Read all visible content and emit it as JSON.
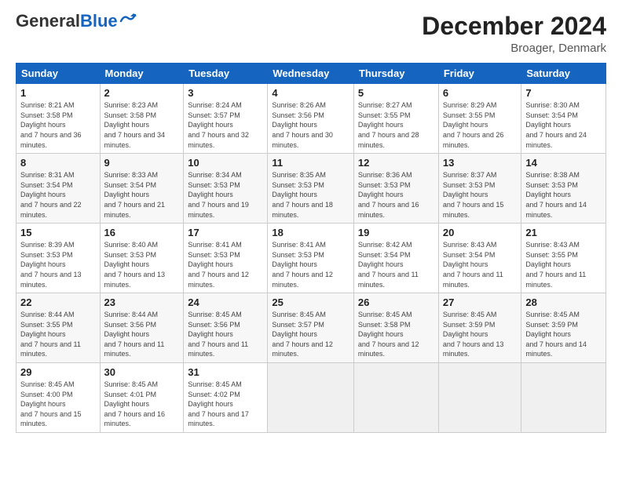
{
  "logo": {
    "general": "General",
    "blue": "Blue"
  },
  "title": "December 2024",
  "location": "Broager, Denmark",
  "days_header": [
    "Sunday",
    "Monday",
    "Tuesday",
    "Wednesday",
    "Thursday",
    "Friday",
    "Saturday"
  ],
  "weeks": [
    [
      {
        "day": "1",
        "sunrise": "8:21 AM",
        "sunset": "3:58 PM",
        "daylight": "7 hours and 36 minutes."
      },
      {
        "day": "2",
        "sunrise": "8:23 AM",
        "sunset": "3:58 PM",
        "daylight": "7 hours and 34 minutes."
      },
      {
        "day": "3",
        "sunrise": "8:24 AM",
        "sunset": "3:57 PM",
        "daylight": "7 hours and 32 minutes."
      },
      {
        "day": "4",
        "sunrise": "8:26 AM",
        "sunset": "3:56 PM",
        "daylight": "7 hours and 30 minutes."
      },
      {
        "day": "5",
        "sunrise": "8:27 AM",
        "sunset": "3:55 PM",
        "daylight": "7 hours and 28 minutes."
      },
      {
        "day": "6",
        "sunrise": "8:29 AM",
        "sunset": "3:55 PM",
        "daylight": "7 hours and 26 minutes."
      },
      {
        "day": "7",
        "sunrise": "8:30 AM",
        "sunset": "3:54 PM",
        "daylight": "7 hours and 24 minutes."
      }
    ],
    [
      {
        "day": "8",
        "sunrise": "8:31 AM",
        "sunset": "3:54 PM",
        "daylight": "7 hours and 22 minutes."
      },
      {
        "day": "9",
        "sunrise": "8:33 AM",
        "sunset": "3:54 PM",
        "daylight": "7 hours and 21 minutes."
      },
      {
        "day": "10",
        "sunrise": "8:34 AM",
        "sunset": "3:53 PM",
        "daylight": "7 hours and 19 minutes."
      },
      {
        "day": "11",
        "sunrise": "8:35 AM",
        "sunset": "3:53 PM",
        "daylight": "7 hours and 18 minutes."
      },
      {
        "day": "12",
        "sunrise": "8:36 AM",
        "sunset": "3:53 PM",
        "daylight": "7 hours and 16 minutes."
      },
      {
        "day": "13",
        "sunrise": "8:37 AM",
        "sunset": "3:53 PM",
        "daylight": "7 hours and 15 minutes."
      },
      {
        "day": "14",
        "sunrise": "8:38 AM",
        "sunset": "3:53 PM",
        "daylight": "7 hours and 14 minutes."
      }
    ],
    [
      {
        "day": "15",
        "sunrise": "8:39 AM",
        "sunset": "3:53 PM",
        "daylight": "7 hours and 13 minutes."
      },
      {
        "day": "16",
        "sunrise": "8:40 AM",
        "sunset": "3:53 PM",
        "daylight": "7 hours and 13 minutes."
      },
      {
        "day": "17",
        "sunrise": "8:41 AM",
        "sunset": "3:53 PM",
        "daylight": "7 hours and 12 minutes."
      },
      {
        "day": "18",
        "sunrise": "8:41 AM",
        "sunset": "3:53 PM",
        "daylight": "7 hours and 12 minutes."
      },
      {
        "day": "19",
        "sunrise": "8:42 AM",
        "sunset": "3:54 PM",
        "daylight": "7 hours and 11 minutes."
      },
      {
        "day": "20",
        "sunrise": "8:43 AM",
        "sunset": "3:54 PM",
        "daylight": "7 hours and 11 minutes."
      },
      {
        "day": "21",
        "sunrise": "8:43 AM",
        "sunset": "3:55 PM",
        "daylight": "7 hours and 11 minutes."
      }
    ],
    [
      {
        "day": "22",
        "sunrise": "8:44 AM",
        "sunset": "3:55 PM",
        "daylight": "7 hours and 11 minutes."
      },
      {
        "day": "23",
        "sunrise": "8:44 AM",
        "sunset": "3:56 PM",
        "daylight": "7 hours and 11 minutes."
      },
      {
        "day": "24",
        "sunrise": "8:45 AM",
        "sunset": "3:56 PM",
        "daylight": "7 hours and 11 minutes."
      },
      {
        "day": "25",
        "sunrise": "8:45 AM",
        "sunset": "3:57 PM",
        "daylight": "7 hours and 12 minutes."
      },
      {
        "day": "26",
        "sunrise": "8:45 AM",
        "sunset": "3:58 PM",
        "daylight": "7 hours and 12 minutes."
      },
      {
        "day": "27",
        "sunrise": "8:45 AM",
        "sunset": "3:59 PM",
        "daylight": "7 hours and 13 minutes."
      },
      {
        "day": "28",
        "sunrise": "8:45 AM",
        "sunset": "3:59 PM",
        "daylight": "7 hours and 14 minutes."
      }
    ],
    [
      {
        "day": "29",
        "sunrise": "8:45 AM",
        "sunset": "4:00 PM",
        "daylight": "7 hours and 15 minutes."
      },
      {
        "day": "30",
        "sunrise": "8:45 AM",
        "sunset": "4:01 PM",
        "daylight": "7 hours and 16 minutes."
      },
      {
        "day": "31",
        "sunrise": "8:45 AM",
        "sunset": "4:02 PM",
        "daylight": "7 hours and 17 minutes."
      },
      null,
      null,
      null,
      null
    ]
  ],
  "labels": {
    "sunrise": "Sunrise:",
    "sunset": "Sunset:",
    "daylight": "Daylight:"
  }
}
